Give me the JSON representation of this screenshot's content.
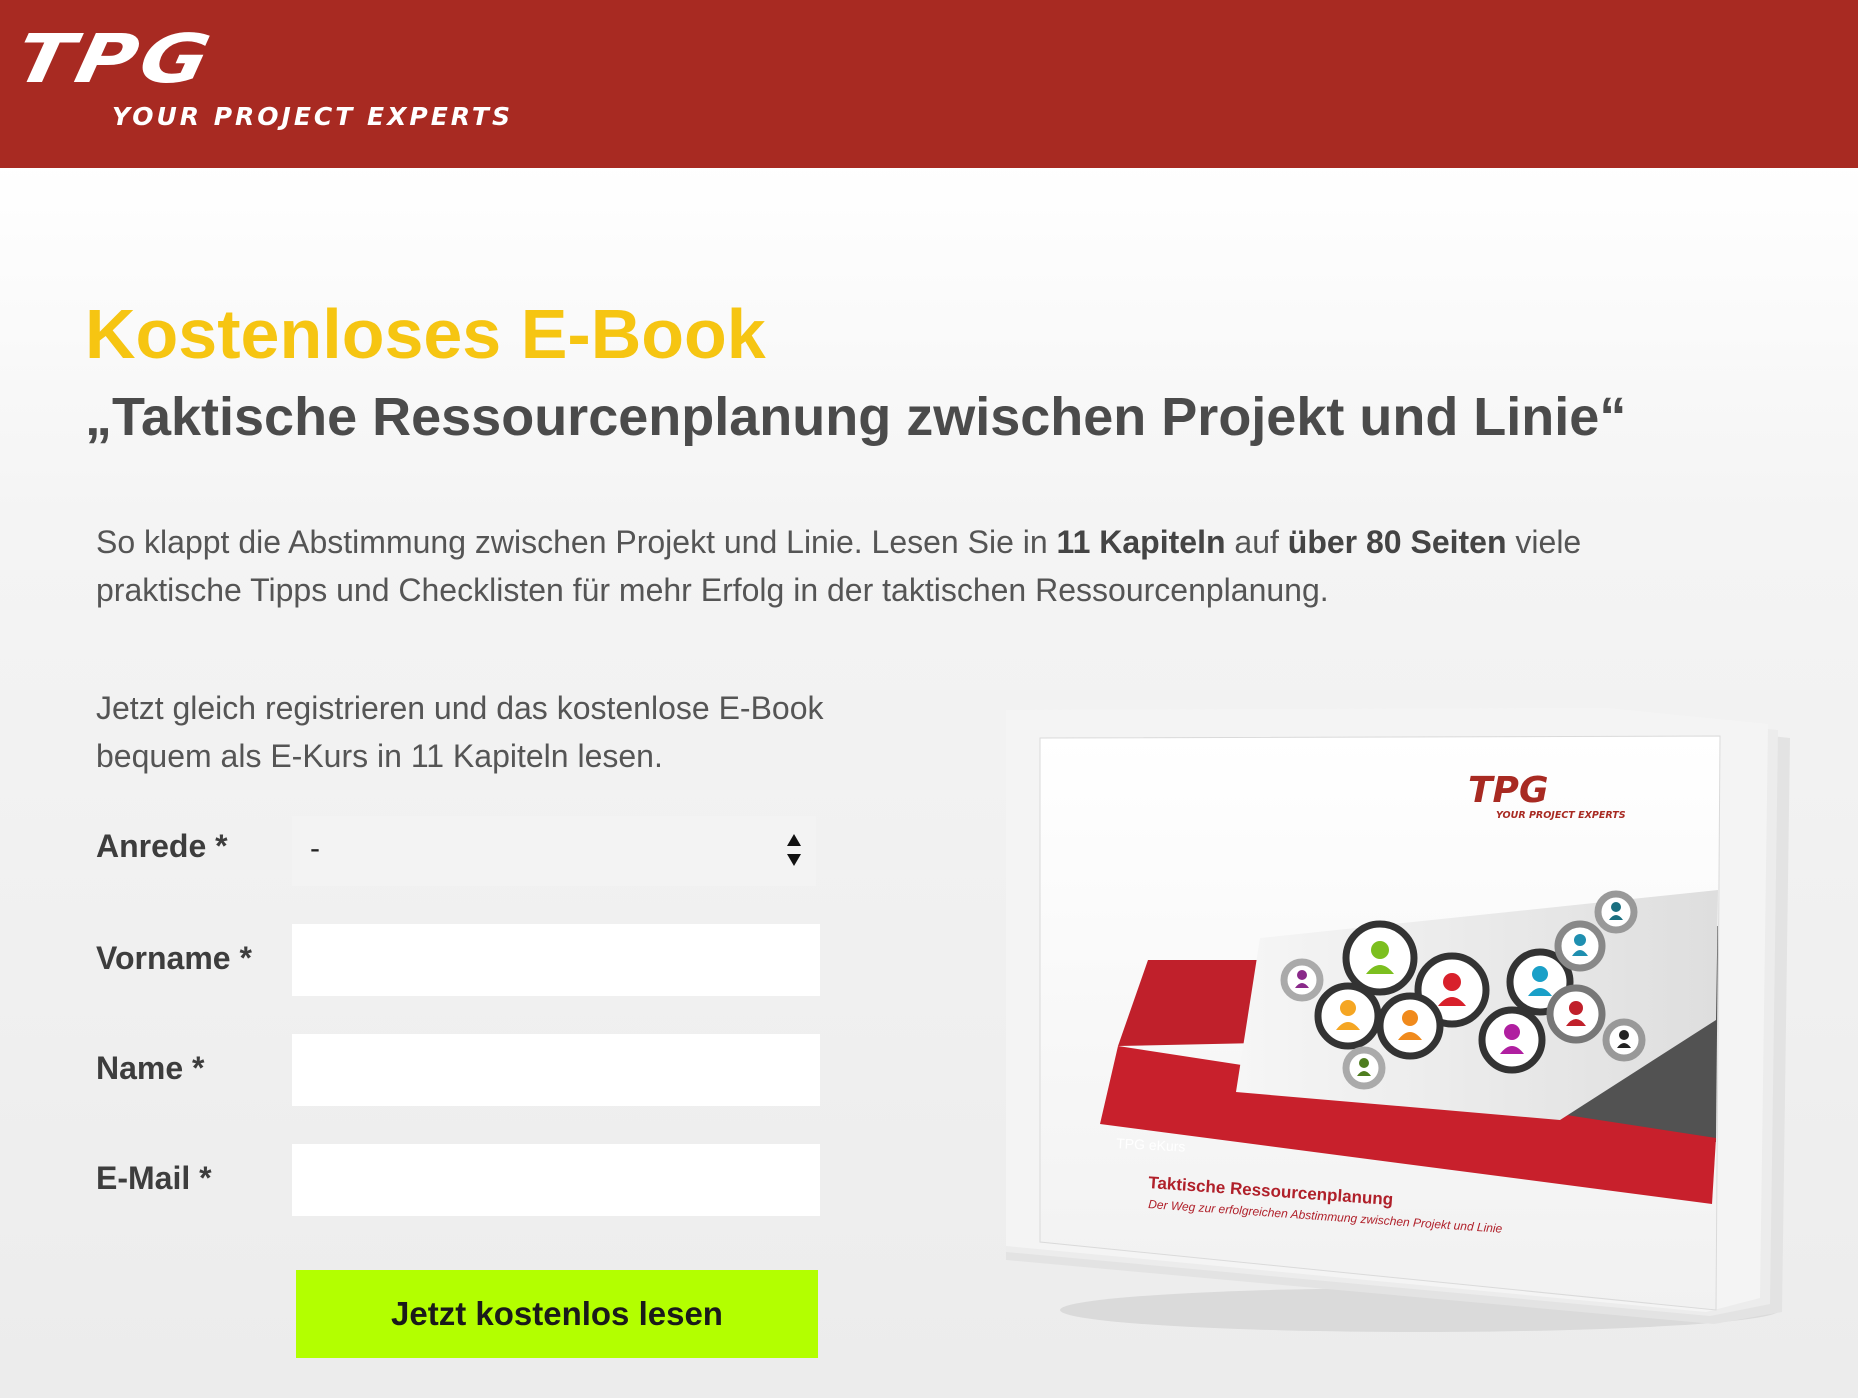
{
  "header": {
    "logo_mark": "TPG",
    "logo_tagline": "YOUR PROJECT EXPERTS",
    "background_color": "#a82a22"
  },
  "hero": {
    "kicker": "Kostenloses E-Book",
    "title": "„Taktische Ressourcenplanung zwischen Projekt und Linie“",
    "intro": {
      "part1": "So klappt die Abstimmung zwischen Projekt und Linie. Lesen Sie in ",
      "bold1": "11 Kapiteln",
      "part2": " auf ",
      "bold2": "über 80 Seiten",
      "part3": " viele praktische Tipps und Checklisten für mehr Erfolg in der taktischen Ressourcenplanung."
    },
    "lead": "Jetzt gleich registrieren und das kostenlose E-Book bequem als E-Kurs in 11 Kapiteln lesen."
  },
  "form": {
    "salutation_label": "Anrede *",
    "salutation_value": "-",
    "firstname_label": "Vorname *",
    "lastname_label": "Name *",
    "email_label": "E-Mail *",
    "submit_label": "Jetzt kostenlos lesen",
    "accent_color": "#b3ff00"
  },
  "book_cover": {
    "logo_mark": "TPG",
    "logo_tagline": "YOUR PROJECT EXPERTS",
    "series": "TPG eKurs",
    "title": "Taktische Ressourcenplanung",
    "subtitle": "Der Weg zur erfolgreichen Abstimmung zwischen Projekt und Linie"
  }
}
